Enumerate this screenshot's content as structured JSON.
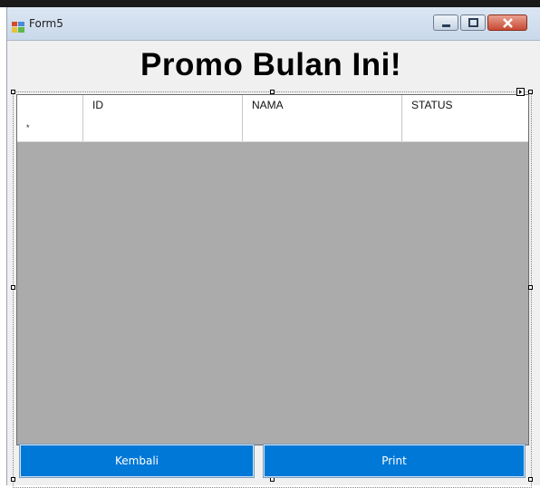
{
  "window": {
    "title": "Form5"
  },
  "heading": "Promo Bulan Ini!",
  "grid": {
    "columns": [
      "",
      "ID",
      "NAMA",
      "STATUS"
    ],
    "new_row_marker": "*",
    "rows": [
      [
        "",
        "",
        ""
      ]
    ]
  },
  "buttons": {
    "back": "Kembali",
    "print": "Print"
  },
  "colors": {
    "button_bg": "#0078d7",
    "grid_bg": "#ababab",
    "close_btn": "#c74a33"
  }
}
